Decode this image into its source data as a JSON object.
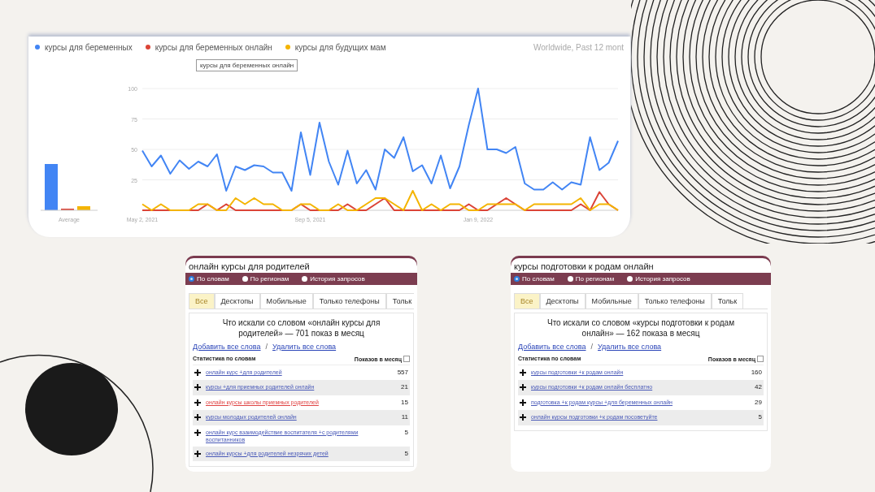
{
  "trends": {
    "tooltip": "курсы для беременных онлайн",
    "scope": "Worldwide, Past 12 mont",
    "average_label": "Average",
    "chart_data": {
      "type": "line",
      "categories": [
        "May 2, 2021",
        null,
        null,
        null,
        null,
        null,
        null,
        null,
        null,
        null,
        null,
        null,
        null,
        null,
        null,
        null,
        null,
        null,
        "Sep 5, 2021",
        null,
        null,
        null,
        null,
        null,
        null,
        null,
        null,
        null,
        null,
        null,
        null,
        null,
        null,
        null,
        null,
        null,
        "Jan 9, 2022",
        null,
        null,
        null,
        null,
        null,
        null,
        null,
        null,
        null,
        null,
        null,
        null,
        null,
        null,
        null
      ],
      "ylim": [
        0,
        100
      ],
      "yticks": [
        25,
        50,
        75,
        100
      ],
      "grid": true,
      "legend": "top",
      "series": [
        {
          "name": "курсы для беременных",
          "color": "#4285f4",
          "values": [
            49,
            36,
            45,
            30,
            41,
            34,
            40,
            36,
            46,
            16,
            36,
            33,
            37,
            36,
            31,
            31,
            16,
            64,
            29,
            72,
            40,
            21,
            49,
            22,
            33,
            17,
            50,
            43,
            60,
            32,
            37,
            22,
            45,
            18,
            36,
            70,
            100,
            50,
            50,
            47,
            52,
            22,
            17,
            17,
            23,
            17,
            23,
            21,
            60,
            33,
            39,
            57
          ]
        },
        {
          "name": "курсы для беременных онлайн",
          "color": "#db4437",
          "values": [
            0,
            0,
            0,
            0,
            0,
            0,
            0,
            5,
            0,
            5,
            0,
            0,
            0,
            0,
            0,
            0,
            0,
            5,
            0,
            0,
            0,
            0,
            5,
            0,
            0,
            5,
            10,
            0,
            0,
            0,
            0,
            0,
            0,
            0,
            0,
            5,
            0,
            0,
            5,
            10,
            5,
            0,
            0,
            0,
            0,
            0,
            0,
            5,
            0,
            15,
            5,
            0
          ]
        },
        {
          "name": "курсы для будущих мам",
          "color": "#f4b400",
          "values": [
            5,
            0,
            5,
            0,
            0,
            0,
            5,
            5,
            0,
            0,
            10,
            5,
            10,
            5,
            5,
            0,
            0,
            5,
            5,
            0,
            0,
            5,
            0,
            0,
            5,
            10,
            10,
            5,
            0,
            16,
            0,
            5,
            0,
            5,
            5,
            0,
            0,
            5,
            5,
            5,
            5,
            0,
            5,
            5,
            5,
            5,
            5,
            10,
            0,
            5,
            5,
            0
          ]
        }
      ]
    }
  },
  "panels": [
    {
      "query": "онлайн курсы для родителей",
      "radios": [
        {
          "label": "По словам",
          "selected": true
        },
        {
          "label": "По регионам",
          "selected": false
        },
        {
          "label": "История запросов",
          "selected": false
        }
      ],
      "tabs": [
        {
          "label": "Все",
          "selected": true
        },
        {
          "label": "Десктопы",
          "selected": false
        },
        {
          "label": "Мобильные",
          "selected": false
        },
        {
          "label": "Только телефоны",
          "selected": false
        },
        {
          "label": "Тольк",
          "selected": false
        }
      ],
      "summary": "Что искали со словом «онлайн курсы для родителей» — 701 показ в месяц",
      "add_all": "Добавить все слова",
      "separator": "/",
      "remove_all": "Удалить все слова",
      "column_1": "Статистика по словам",
      "column_2": "Показов в месяц",
      "rows": [
        {
          "phrase": "онлайн курс +для родителей",
          "count": "557",
          "highlighted": false
        },
        {
          "phrase": "курсы +для приемных родителей онлайн",
          "count": "21",
          "highlighted": false
        },
        {
          "phrase": "онлайн курсы школы приемных родителей",
          "count": "15",
          "highlighted": true
        },
        {
          "phrase": "курсы молодых родителей онлайн",
          "count": "11",
          "highlighted": false
        },
        {
          "phrase": "онлайн курс взаимодействие воспитателя +с родителями воспитанников",
          "count": "5",
          "highlighted": false
        },
        {
          "phrase": "онлайн курсы +для родителей незрячих детей",
          "count": "5",
          "highlighted": false
        }
      ]
    },
    {
      "query": "курсы подготовки к родам онлайн",
      "radios": [
        {
          "label": "По словам",
          "selected": true
        },
        {
          "label": "По регионам",
          "selected": false
        },
        {
          "label": "История запросов",
          "selected": false
        }
      ],
      "tabs": [
        {
          "label": "Все",
          "selected": true
        },
        {
          "label": "Десктопы",
          "selected": false
        },
        {
          "label": "Мобильные",
          "selected": false
        },
        {
          "label": "Только телефоны",
          "selected": false
        },
        {
          "label": "Тольк",
          "selected": false
        }
      ],
      "summary": "Что искали со словом «курсы подготовки к родам онлайн» — 162 показа в месяц",
      "add_all": "Добавить все слова",
      "separator": "/",
      "remove_all": "Удалить все слова",
      "column_1": "Статистика по словам",
      "column_2": "Показов в месяц",
      "rows": [
        {
          "phrase": "курсы подготовки +к родам онлайн",
          "count": "160",
          "highlighted": false
        },
        {
          "phrase": "курсы подготовки +к родам онлайн бесплатно",
          "count": "42",
          "highlighted": false
        },
        {
          "phrase": "подготовка +к родам курсы +для беременных онлайн",
          "count": "29",
          "highlighted": false
        },
        {
          "phrase": "онлайн курсы подготовки +к родам посоветуйте",
          "count": "5",
          "highlighted": false
        }
      ]
    }
  ]
}
